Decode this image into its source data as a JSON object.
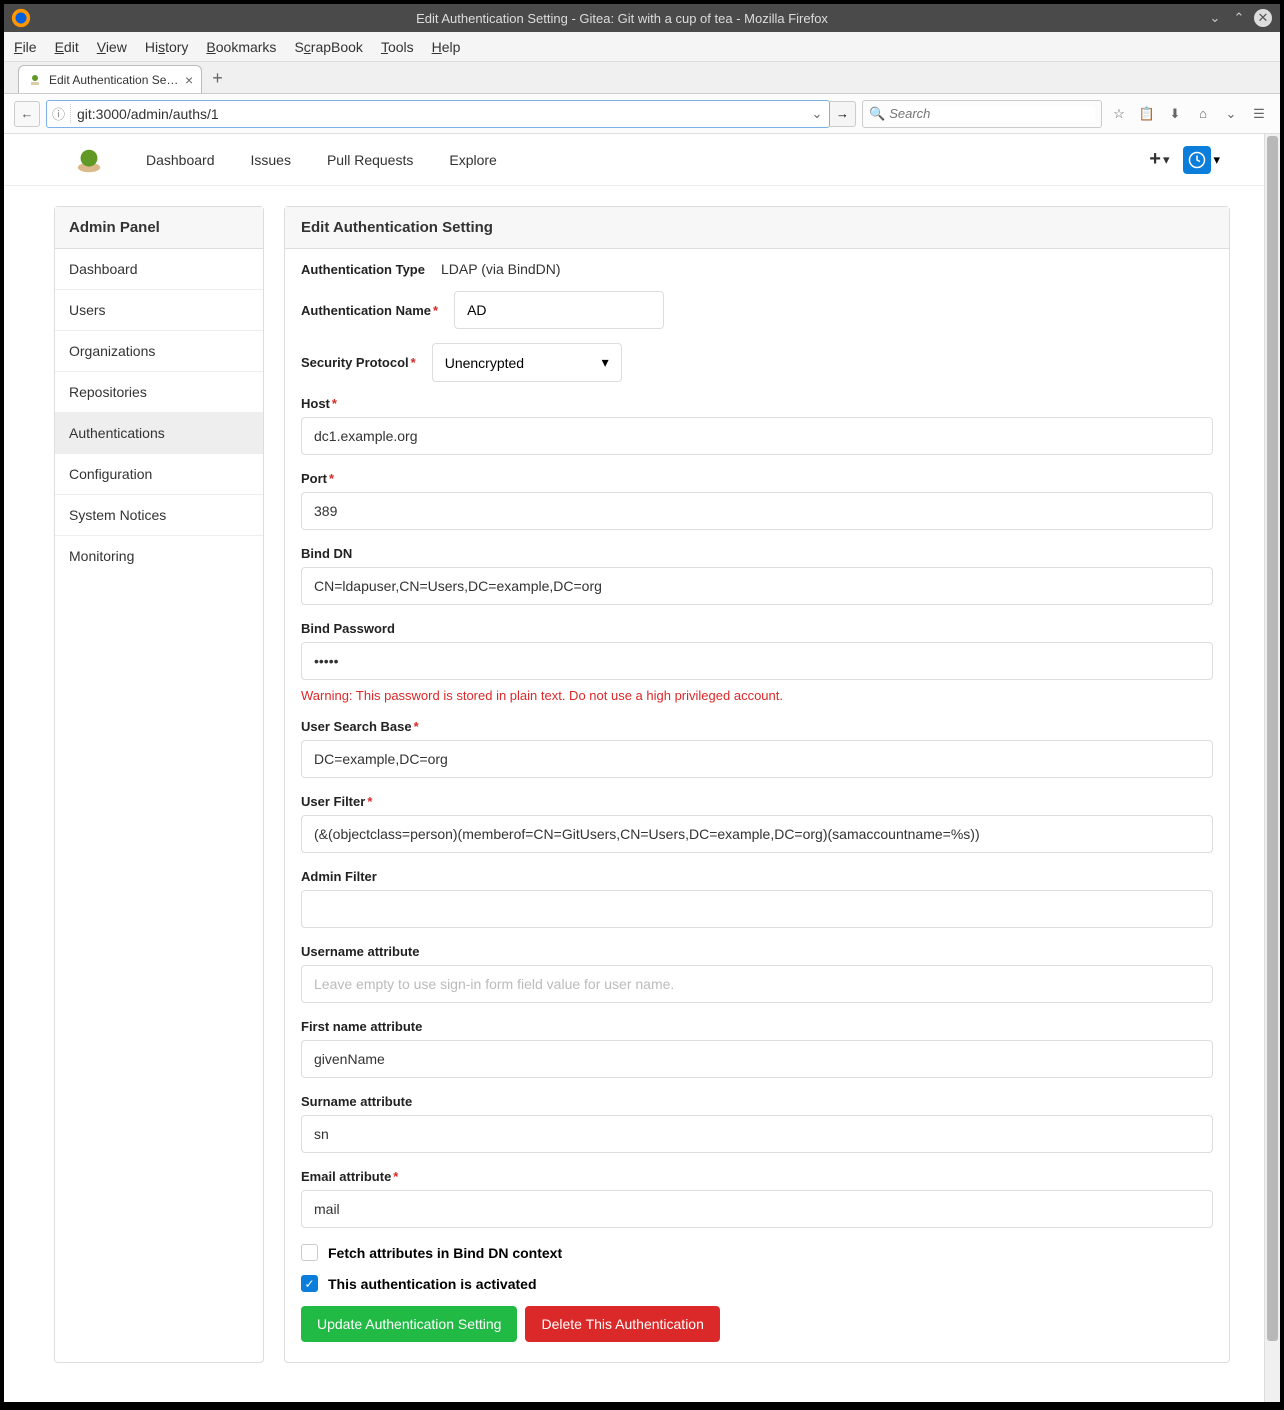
{
  "window": {
    "title": "Edit Authentication Setting - Gitea: Git with a cup of tea - Mozilla Firefox"
  },
  "menubar": [
    "File",
    "Edit",
    "View",
    "History",
    "Bookmarks",
    "ScrapBook",
    "Tools",
    "Help"
  ],
  "tab": {
    "title": "Edit Authentication Sett..."
  },
  "url": {
    "value": "git:3000/admin/auths/1"
  },
  "search": {
    "placeholder": "Search"
  },
  "gitea_nav": [
    "Dashboard",
    "Issues",
    "Pull Requests",
    "Explore"
  ],
  "sidebar": {
    "header": "Admin Panel",
    "items": [
      "Dashboard",
      "Users",
      "Organizations",
      "Repositories",
      "Authentications",
      "Configuration",
      "System Notices",
      "Monitoring"
    ],
    "active_index": 4
  },
  "panel": {
    "title": "Edit Authentication Setting"
  },
  "form": {
    "auth_type": {
      "label": "Authentication Type",
      "value": "LDAP (via BindDN)"
    },
    "auth_name": {
      "label": "Authentication Name",
      "value": "AD"
    },
    "security_protocol": {
      "label": "Security Protocol",
      "value": "Unencrypted"
    },
    "host": {
      "label": "Host",
      "value": "dc1.example.org"
    },
    "port": {
      "label": "Port",
      "value": "389"
    },
    "bind_dn": {
      "label": "Bind DN",
      "value": "CN=ldapuser,CN=Users,DC=example,DC=org"
    },
    "bind_password": {
      "label": "Bind Password",
      "value": "•••••",
      "warning": "Warning: This password is stored in plain text. Do not use a high privileged account."
    },
    "user_search_base": {
      "label": "User Search Base",
      "value": "DC=example,DC=org"
    },
    "user_filter": {
      "label": "User Filter",
      "value": "(&(objectclass=person)(memberof=CN=GitUsers,CN=Users,DC=example,DC=org)(samaccountname=%s))"
    },
    "admin_filter": {
      "label": "Admin Filter",
      "value": ""
    },
    "username_attr": {
      "label": "Username attribute",
      "value": "",
      "placeholder": "Leave empty to use sign-in form field value for user name."
    },
    "first_name_attr": {
      "label": "First name attribute",
      "value": "givenName"
    },
    "surname_attr": {
      "label": "Surname attribute",
      "value": "sn"
    },
    "email_attr": {
      "label": "Email attribute",
      "value": "mail"
    },
    "fetch_bind_dn": {
      "label": "Fetch attributes in Bind DN context",
      "checked": false
    },
    "activated": {
      "label": "This authentication is activated",
      "checked": true
    },
    "update_btn": "Update Authentication Setting",
    "delete_btn": "Delete This Authentication"
  }
}
